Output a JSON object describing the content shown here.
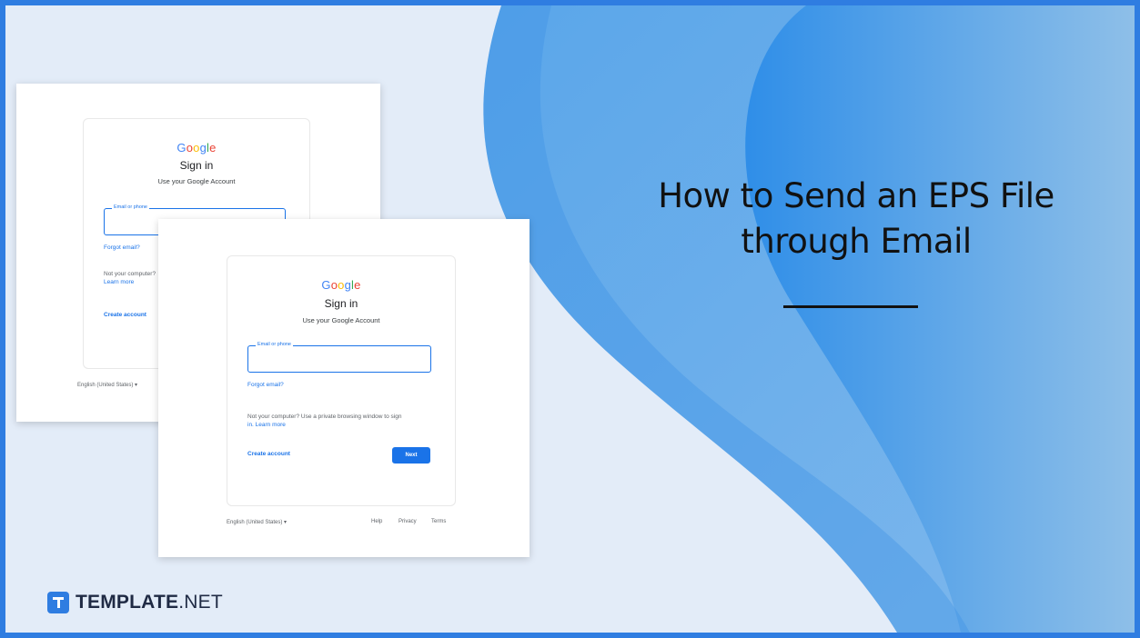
{
  "headline": {
    "line1": "How to Send an EPS File",
    "line2": "through Email"
  },
  "brand": {
    "name": "TEMPLATE",
    "suffix": ".NET"
  },
  "signin_back": {
    "logo_letters": [
      "G",
      "o",
      "o",
      "g",
      "l",
      "e"
    ],
    "title": "Sign in",
    "subtitle": "Use your Google Account",
    "email_label": "Email or phone",
    "forgot_email": "Forgot email?",
    "guest_text": "Not your computer?",
    "learn_more": "Learn more",
    "create_account": "Create account",
    "language": "English (United States) ▾"
  },
  "signin_front": {
    "logo_letters": [
      "G",
      "o",
      "o",
      "g",
      "l",
      "e"
    ],
    "title": "Sign in",
    "subtitle": "Use your Google Account",
    "email_label": "Email or phone",
    "forgot_email": "Forgot email?",
    "guest_text": "Not your computer? Use a private browsing window to sign",
    "learn_more": "in. Learn more",
    "create_account": "Create account",
    "next_button": "Next",
    "language": "English (United States) ▾",
    "footer_links": [
      "Help",
      "Privacy",
      "Terms"
    ]
  },
  "colors": {
    "frame": "#2f7de1",
    "background": "#e3ecf8",
    "wave_light": "#6aaee9",
    "wave_dark": "#3d95e6",
    "accent": "#1a73e8"
  }
}
